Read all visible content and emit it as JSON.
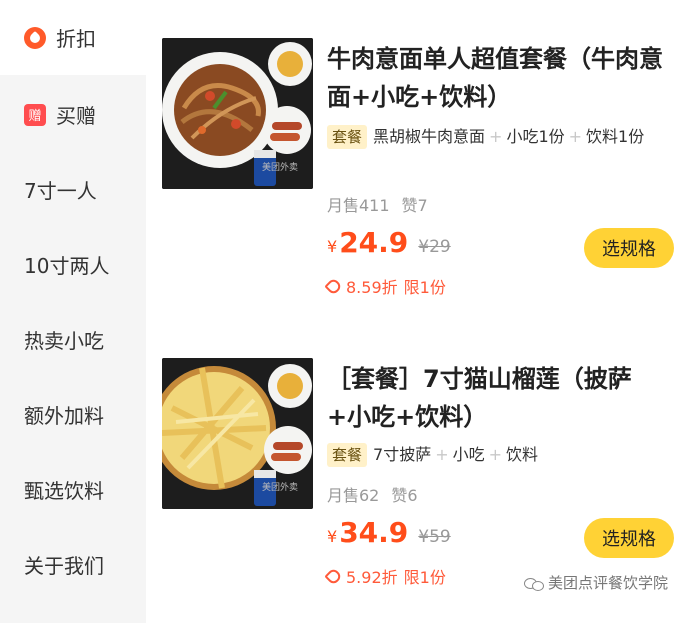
{
  "sidebar": {
    "items": [
      {
        "label": "折扣",
        "icon": "discount-icon"
      },
      {
        "label": "买赠",
        "icon": "gift-icon",
        "icon_text": "赠"
      },
      {
        "label": "7寸一人"
      },
      {
        "label": "10寸两人"
      },
      {
        "label": "热卖小吃"
      },
      {
        "label": "额外加料"
      },
      {
        "label": "甄选饮料"
      },
      {
        "label": "关于我们"
      }
    ]
  },
  "products": [
    {
      "title": "牛肉意面单人超值套餐（牛肉意面+小吃+饮料）",
      "badge": "套餐",
      "items": [
        "黑胡椒牛肉意面",
        "小吃1份",
        "饮料1份"
      ],
      "separator": "+",
      "sales": "月售411",
      "likes": "赞7",
      "currency": "¥",
      "price": "24.9",
      "original_price": "¥29",
      "discount": "8.59折",
      "limit": "限1份",
      "button": "选规格",
      "image": "pasta-set-photo",
      "image_overlay_text": "美团外卖"
    },
    {
      "title": "［套餐］7寸猫山榴莲（披萨+小吃+饮料）",
      "badge": "套餐",
      "items": [
        "7寸披萨",
        "小吃",
        "饮料"
      ],
      "separator": "+",
      "sales": "月售62",
      "likes": "赞6",
      "currency": "¥",
      "price": "34.9",
      "original_price": "¥59",
      "discount": "5.92折",
      "limit": "限1份",
      "button": "选规格",
      "image": "durian-pizza-set-photo",
      "image_overlay_text": "美团外卖"
    }
  ],
  "watermark": "美团点评餐饮学院",
  "colors": {
    "accent": "#ff4d1a",
    "button": "#ffd235",
    "sidebar_bg": "#f5f5f5",
    "badge_bg": "#fff1c9"
  }
}
